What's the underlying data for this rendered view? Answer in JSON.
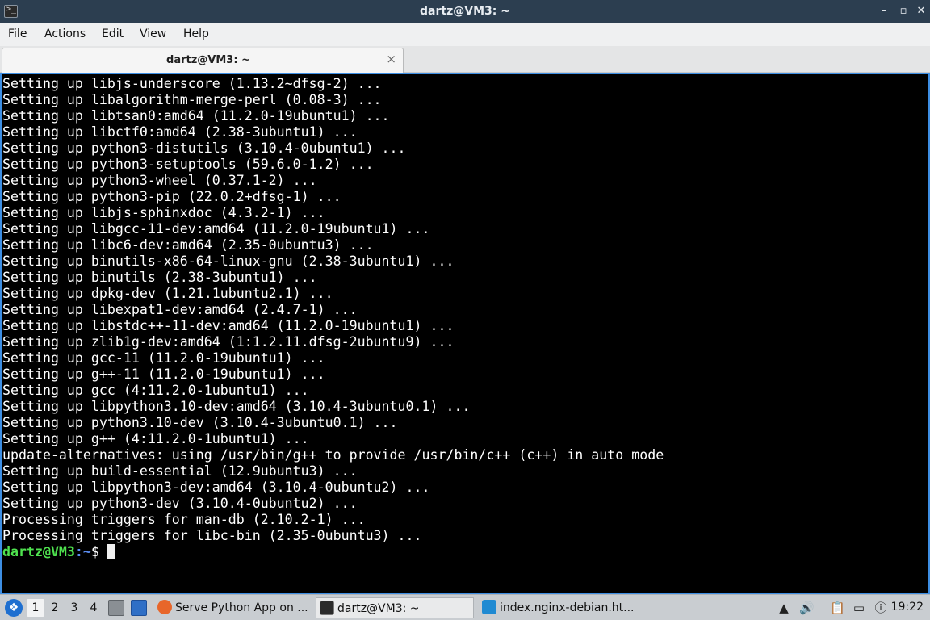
{
  "window": {
    "title": "dartz@VM3: ~",
    "app_icon": "terminal-icon"
  },
  "menu": {
    "items": [
      "File",
      "Actions",
      "Edit",
      "View",
      "Help"
    ]
  },
  "tabs": [
    {
      "label": "dartz@VM3: ~",
      "close": "×"
    }
  ],
  "terminal": {
    "lines": [
      "Setting up libjs-underscore (1.13.2~dfsg-2) ...",
      "Setting up libalgorithm-merge-perl (0.08-3) ...",
      "Setting up libtsan0:amd64 (11.2.0-19ubuntu1) ...",
      "Setting up libctf0:amd64 (2.38-3ubuntu1) ...",
      "Setting up python3-distutils (3.10.4-0ubuntu1) ...",
      "Setting up python3-setuptools (59.6.0-1.2) ...",
      "Setting up python3-wheel (0.37.1-2) ...",
      "Setting up python3-pip (22.0.2+dfsg-1) ...",
      "Setting up libjs-sphinxdoc (4.3.2-1) ...",
      "Setting up libgcc-11-dev:amd64 (11.2.0-19ubuntu1) ...",
      "Setting up libc6-dev:amd64 (2.35-0ubuntu3) ...",
      "Setting up binutils-x86-64-linux-gnu (2.38-3ubuntu1) ...",
      "Setting up binutils (2.38-3ubuntu1) ...",
      "Setting up dpkg-dev (1.21.1ubuntu2.1) ...",
      "Setting up libexpat1-dev:amd64 (2.4.7-1) ...",
      "Setting up libstdc++-11-dev:amd64 (11.2.0-19ubuntu1) ...",
      "Setting up zlib1g-dev:amd64 (1:1.2.11.dfsg-2ubuntu9) ...",
      "Setting up gcc-11 (11.2.0-19ubuntu1) ...",
      "Setting up g++-11 (11.2.0-19ubuntu1) ...",
      "Setting up gcc (4:11.2.0-1ubuntu1) ...",
      "Setting up libpython3.10-dev:amd64 (3.10.4-3ubuntu0.1) ...",
      "Setting up python3.10-dev (3.10.4-3ubuntu0.1) ...",
      "Setting up g++ (4:11.2.0-1ubuntu1) ...",
      "update-alternatives: using /usr/bin/g++ to provide /usr/bin/c++ (c++) in auto mode",
      "Setting up build-essential (12.9ubuntu3) ...",
      "Setting up libpython3-dev:amd64 (3.10.4-0ubuntu2) ...",
      "Setting up python3-dev (3.10.4-0ubuntu2) ...",
      "Processing triggers for man-db (2.10.2-1) ...",
      "Processing triggers for libc-bin (2.35-0ubuntu3) ..."
    ],
    "prompt": {
      "user_host": "dartz@VM3",
      "path": ":~",
      "symbol": "$"
    },
    "colors": {
      "background": "#000000",
      "text": "#ffffff",
      "prompt_user": "#4fe34f",
      "prompt_path": "#5b8cf0",
      "focus_border": "#3d8ee3"
    }
  },
  "taskbar": {
    "start_icon": "lxqt-start-icon",
    "workspaces": [
      "1",
      "2",
      "3",
      "4"
    ],
    "active_workspace": "1",
    "quick_launch": [
      "file-manager-icon",
      "show-desktop-icon"
    ],
    "tasks": [
      {
        "label": "Serve Python App on ...",
        "icon": "firefox-icon"
      },
      {
        "label": "dartz@VM3: ~",
        "icon": "terminal-icon"
      },
      {
        "label": "index.nginx-debian.ht...",
        "icon": "vscode-icon"
      }
    ],
    "tray": [
      "updates-icon",
      "volume-icon",
      "clipboard-icon",
      "network-icon",
      "notification-icon"
    ],
    "clock": "19:22"
  }
}
